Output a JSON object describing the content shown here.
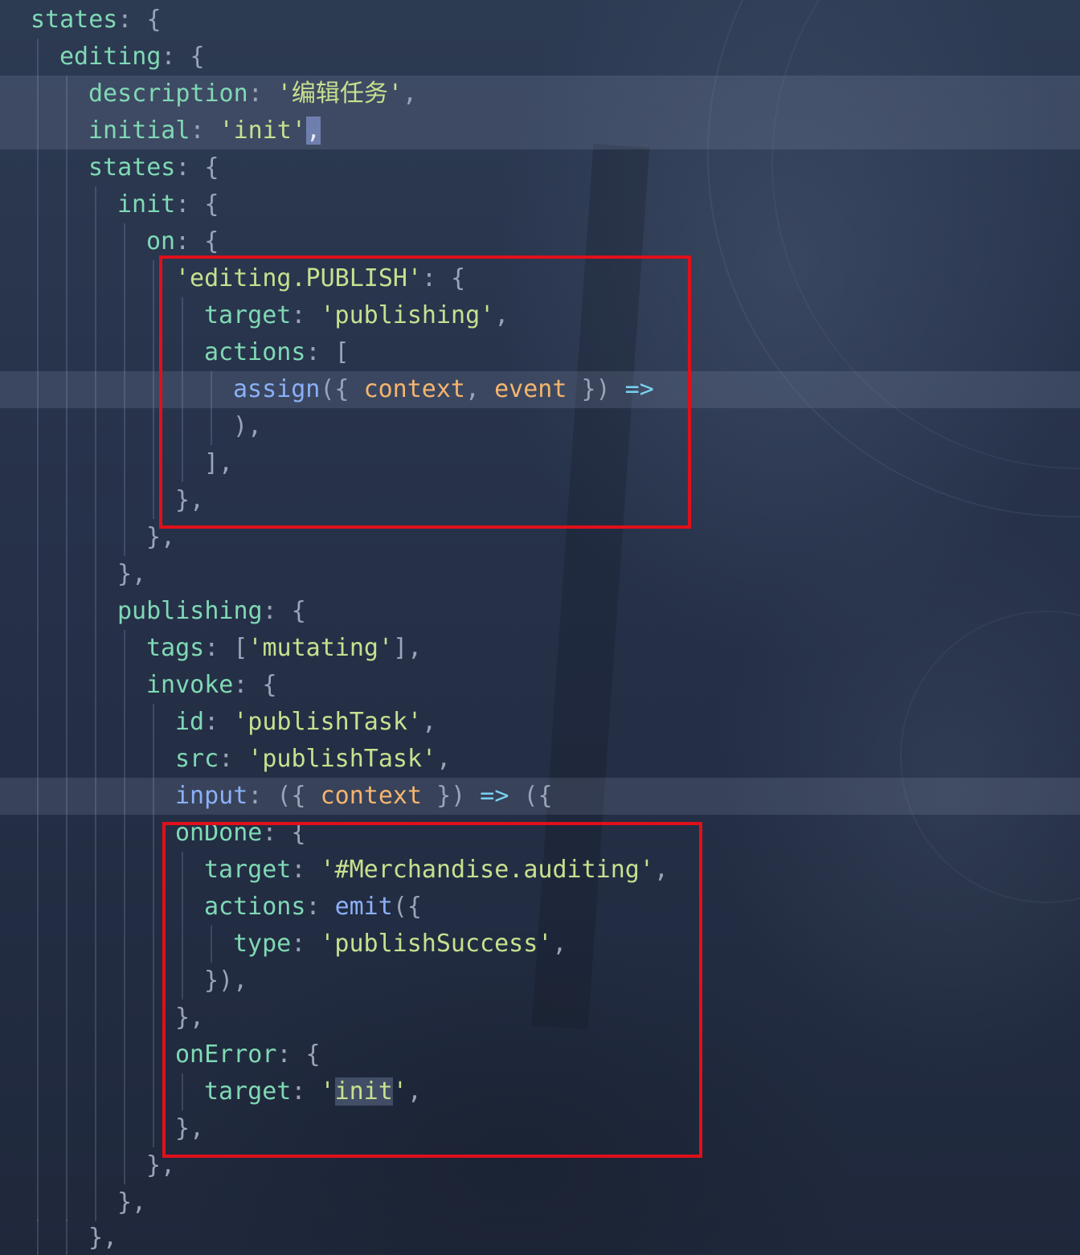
{
  "colors": {
    "key": "#7fd9b4",
    "string": "#c8e08e",
    "punctuation": "#9aa3b8",
    "function": "#8ab0f6",
    "variable": "#f5b56e",
    "operator": "#7ad2f0",
    "highlight_box": "#e0101b"
  },
  "code": {
    "l01": {
      "key": "states",
      "p": ": {"
    },
    "l02": {
      "key": "editing",
      "p": ": {"
    },
    "l03": {
      "key": "description",
      "p1": ": ",
      "str": "'编辑任务'",
      "p2": ","
    },
    "l04": {
      "key": "initial",
      "p1": ": ",
      "str": "'init'",
      "cursor": ",",
      "p2": ""
    },
    "l05": {
      "key": "states",
      "p": ": {"
    },
    "l06": {
      "key": "init",
      "p": ": {"
    },
    "l07": {
      "key": "on",
      "p": ": {"
    },
    "l08": {
      "str": "'editing.PUBLISH'",
      "p": ": {"
    },
    "l09": {
      "key": "target",
      "p1": ": ",
      "str": "'publishing'",
      "p2": ","
    },
    "l10": {
      "key": "actions",
      "p": ": ["
    },
    "l11": {
      "fn": "assign",
      "p1": "({ ",
      "v1": "context",
      "p2": ", ",
      "v2": "event",
      "p3": " })",
      "op": " =>"
    },
    "l12": {
      "p": "),"
    },
    "l13": {
      "p": "],"
    },
    "l14": {
      "p": "},"
    },
    "l15": {
      "p": "},"
    },
    "l16": {
      "p": "},"
    },
    "l17": {
      "key": "publishing",
      "p": ": {"
    },
    "l18": {
      "key": "tags",
      "p1": ": [",
      "str": "'mutating'",
      "p2": "],"
    },
    "l19": {
      "key": "invoke",
      "p": ": {"
    },
    "l20": {
      "key": "id",
      "p1": ": ",
      "str": "'publishTask'",
      "p2": ","
    },
    "l21": {
      "key": "src",
      "p1": ": ",
      "str": "'publishTask'",
      "p2": ","
    },
    "l22": {
      "key": "input",
      "p1": ": ({ ",
      "v": "context",
      "p2": " })",
      "op": " =>",
      "p3": " ({"
    },
    "l23": {
      "key": "onDone",
      "p": ": {"
    },
    "l24": {
      "key": "target",
      "p1": ": ",
      "str": "'#Merchandise.auditing'",
      "p2": ","
    },
    "l25": {
      "key": "actions",
      "p1": ": ",
      "fn": "emit",
      "p2": "({"
    },
    "l26": {
      "key": "type",
      "p1": ": ",
      "str": "'publishSuccess'",
      "p2": ","
    },
    "l27": {
      "p": "}),"
    },
    "l28": {
      "p": "},"
    },
    "l29": {
      "key": "onError",
      "p": ": {"
    },
    "l30": {
      "key": "target",
      "p1": ": ",
      "q1": "'",
      "match": "init",
      "q2": "'",
      "p2": ","
    },
    "l31": {
      "p": "},"
    },
    "l32": {
      "p": "},"
    },
    "l33": {
      "p": "},"
    },
    "l34": {
      "p": "},"
    }
  }
}
